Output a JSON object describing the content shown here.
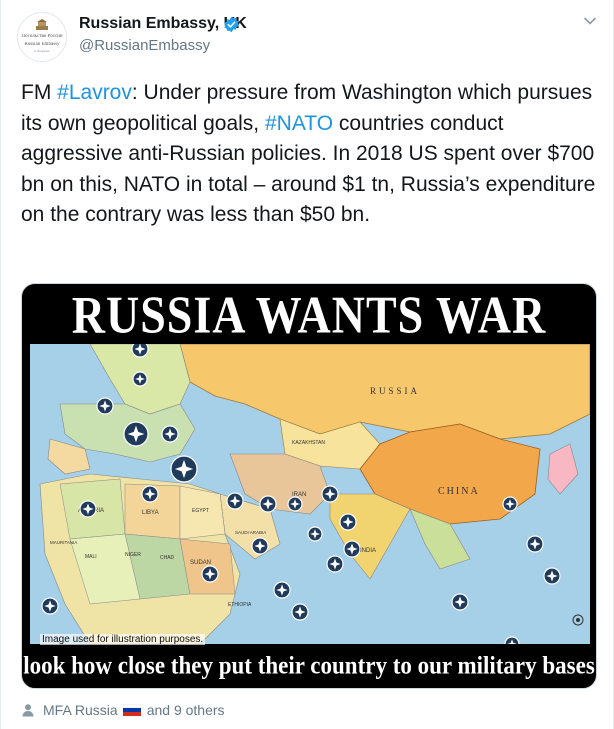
{
  "account": {
    "name": "Russian Embassy, UK",
    "handle": "@RussianEmbassy",
    "avatar_lines": [
      "Посольство России",
      "Russian Embassy",
      "в Лондоне"
    ],
    "verified_color": "#1da1f2",
    "avatar_icon": "embassy-crest-icon"
  },
  "tweet": {
    "prefix": "FM ",
    "hashtag_1": "#Lavrov",
    "part_1": ": Under pressure from Washington which pursues its own geopolitical goals, ",
    "hashtag_2": "#NATO",
    "part_2": " countries conduct aggressive anti-Russian policies. In 2018 US spent over $700 bn on this, NATO in total – around $1 tn, Russia’s expenditure on the contrary was less than $50 bn."
  },
  "image": {
    "top_banner": "RUSSIA WANTS WAR",
    "bottom_banner": "look how close they put their country to our military bases",
    "illustration_note": "Image used for illustration purposes.",
    "map_labels": [
      "RUSSIA",
      "KAZAKHSTAN",
      "CHINA",
      "INDIA",
      "IRAN",
      "LIBYA",
      "EGYPT",
      "ALGERIA",
      "SUDAN",
      "NIGER",
      "MALI",
      "CHAD",
      "ETHIOPIA",
      "MAURITANIA",
      "SAUDI ARABIA"
    ],
    "marker_icon": "nato-star-icon",
    "marker_count": 26
  },
  "likers": {
    "first": "MFA Russia",
    "rest": "and 9 others",
    "icon": "person-icon",
    "flag_icon": "russia-flag-icon"
  },
  "colors": {
    "link": "#1b95e0",
    "secondary": "#657786",
    "text": "#14171a",
    "russia": "#f6c76b",
    "china": "#f2a84a",
    "sea": "#a6cfe8",
    "marker": "#1f3a5a"
  }
}
